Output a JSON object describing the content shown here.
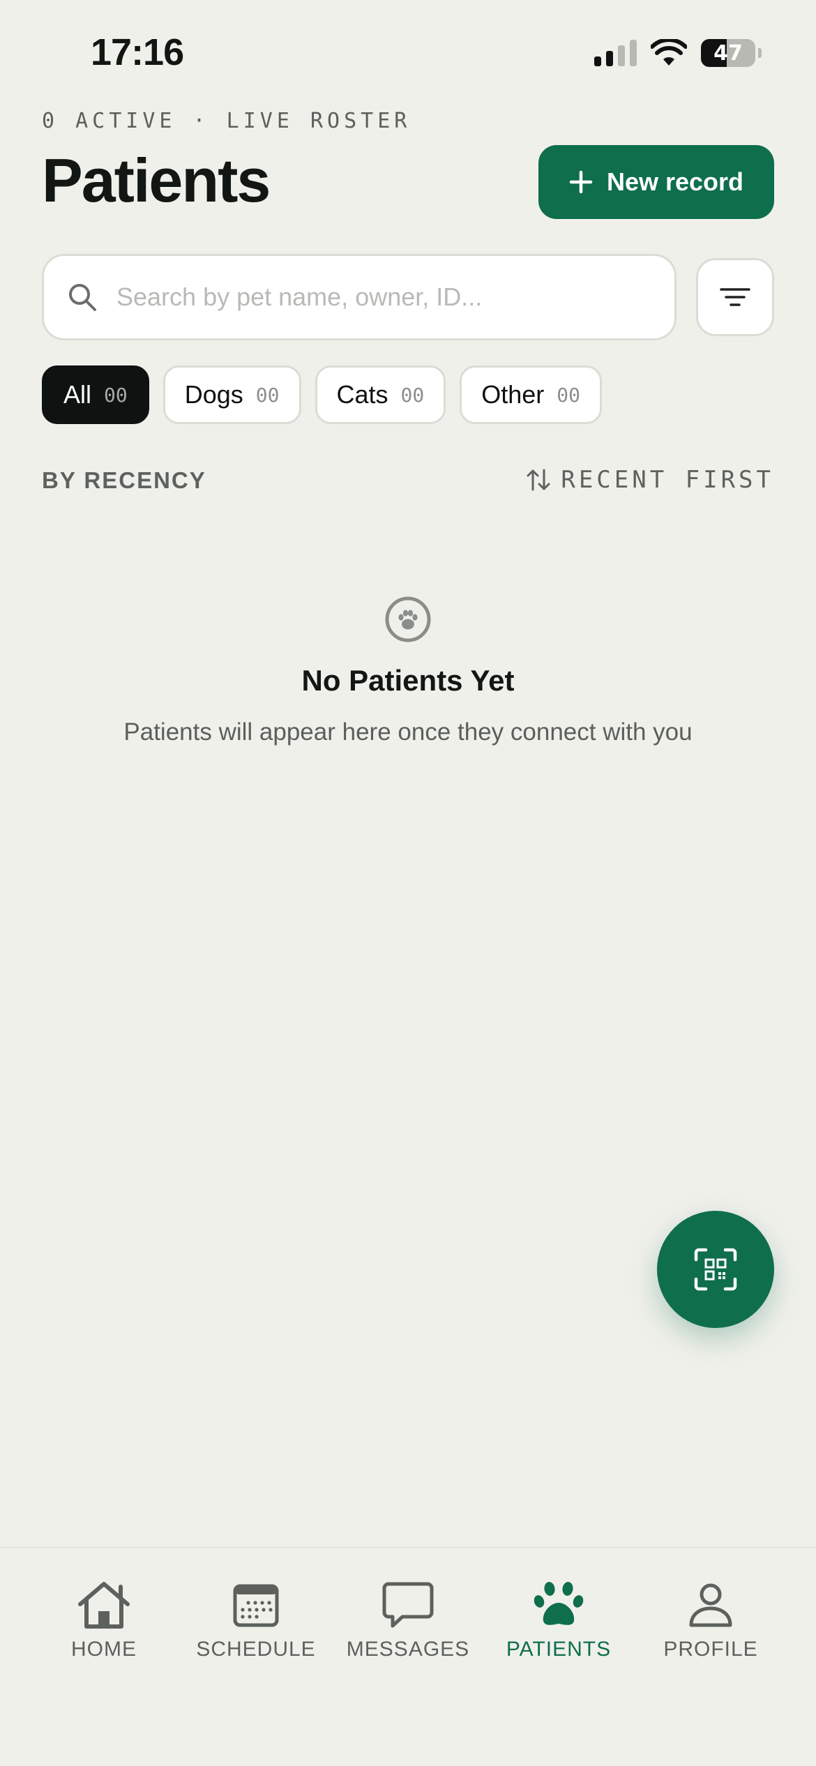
{
  "status_bar": {
    "time": "17:16",
    "battery": "47"
  },
  "header": {
    "eyebrow": "0 ACTIVE · LIVE ROSTER",
    "title": "Patients",
    "new_record_label": "New record"
  },
  "search": {
    "placeholder": "Search by pet name, owner, ID..."
  },
  "filters": [
    {
      "label": "All",
      "count": "00",
      "active": true
    },
    {
      "label": "Dogs",
      "count": "00",
      "active": false
    },
    {
      "label": "Cats",
      "count": "00",
      "active": false
    },
    {
      "label": "Other",
      "count": "00",
      "active": false
    }
  ],
  "sort": {
    "group_label": "BY RECENCY",
    "order_label": "RECENT FIRST"
  },
  "empty_state": {
    "title": "No Patients Yet",
    "subtitle": "Patients will appear here once they connect with you"
  },
  "tabs": [
    {
      "label": "HOME",
      "icon": "home-icon",
      "active": false
    },
    {
      "label": "SCHEDULE",
      "icon": "calendar-icon",
      "active": false
    },
    {
      "label": "MESSAGES",
      "icon": "chat-bubble-icon",
      "active": false
    },
    {
      "label": "PATIENTS",
      "icon": "paw-icon",
      "active": true
    },
    {
      "label": "PROFILE",
      "icon": "person-icon",
      "active": false
    }
  ],
  "colors": {
    "accent": "#0f6e4c",
    "background": "#f0f0eb",
    "chip_active": "#0e1210"
  }
}
